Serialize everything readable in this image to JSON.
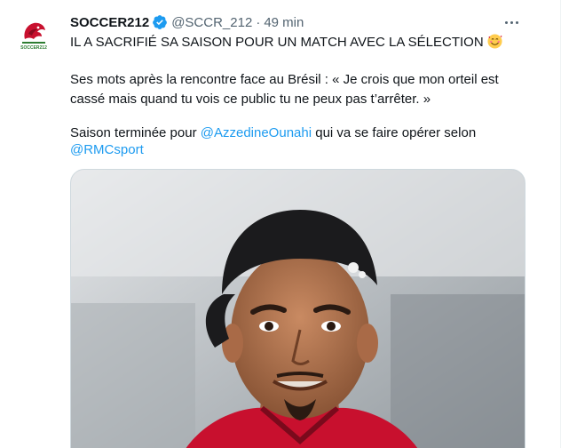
{
  "tweet": {
    "author": {
      "display_name": "SOCCER212",
      "handle": "@SCCR_212",
      "verified": true,
      "avatar_icon": "soccer212-lion-logo",
      "avatar_logo_text": "SOCCER212"
    },
    "separator": "·",
    "time": "49 min",
    "text": {
      "line1": "IL A SACRIFIÉ SA SAISON POUR UN MATCH AVEC LA SÉLECTION",
      "line1_emoji": "smiling-face-with-hearts-emoji",
      "line2": "Ses mots après la rencontre face au Brésil : « Je crois que mon orteil est",
      "line3": "cassé mais quand tu vois ce public tu ne peux pas t’arrêter. »",
      "line4_prefix": "Saison terminée pour ",
      "mention1": "@AzzedineOunahi",
      "line4_suffix": " qui va se faire opérer selon",
      "mention2": "@RMCsport"
    },
    "media_description": "photo-of-player-wearing-backwards-black-cap",
    "colors": {
      "link": "#1d9bf0",
      "verified": "#1d9bf0",
      "secondary_text": "#536471"
    }
  }
}
